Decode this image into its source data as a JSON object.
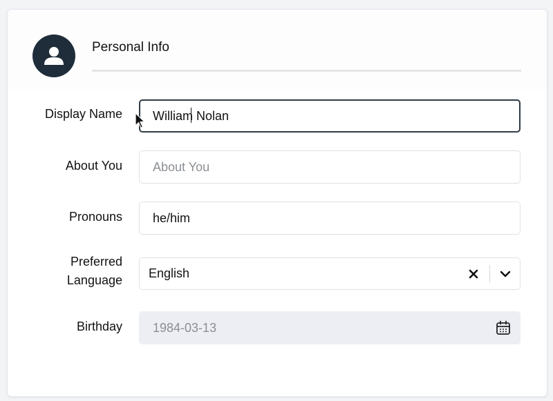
{
  "section": {
    "title": "Personal Info"
  },
  "fields": {
    "display_name": {
      "label": "Display Name",
      "value": "William Nolan"
    },
    "about_you": {
      "label": "About You",
      "placeholder": "About You",
      "value": ""
    },
    "pronouns": {
      "label": "Pronouns",
      "value": "he/him"
    },
    "preferred_language": {
      "label_line1": "Preferred",
      "label_line2": "Language",
      "value": "English"
    },
    "birthday": {
      "label": "Birthday",
      "value": "1984-03-13"
    }
  },
  "icons": {
    "avatar": "user-icon",
    "clear": "close-icon",
    "dropdown": "chevron-down-icon",
    "calendar": "calendar-icon"
  },
  "colors": {
    "avatar_bg": "#1f2d3a",
    "focus_border": "#2f3b45",
    "disabled_bg": "#eceef4"
  }
}
